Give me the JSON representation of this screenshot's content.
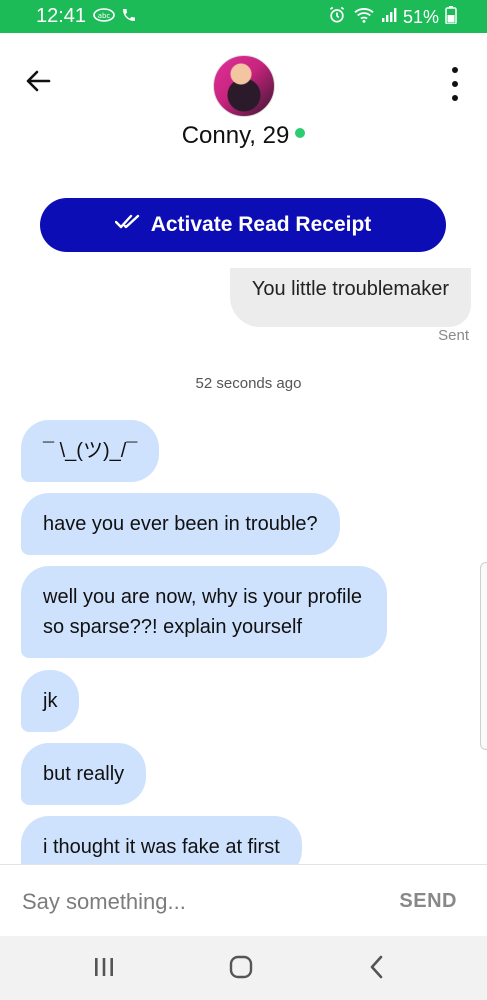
{
  "status_bar": {
    "time": "12:41",
    "battery": "51%",
    "icons": [
      "carrier-icon",
      "phone-icon",
      "alarm-icon",
      "wifi-icon",
      "signal-icon",
      "battery-icon"
    ],
    "background": "#1dbb58"
  },
  "header": {
    "name": "Conny, 29",
    "online": true,
    "online_color": "#2ecc71"
  },
  "activate_button": {
    "label": "Activate Read Receipt",
    "color": "#0d0db5"
  },
  "messages": {
    "sent": {
      "text": "You little troublemaker",
      "status": "Sent"
    },
    "timestamp": "52 seconds ago",
    "received": [
      {
        "text": "¯ \\_(ツ)_/¯"
      },
      {
        "text": "have you ever been in trouble?"
      },
      {
        "text": "well you are now, why is your profile so sparse??! explain yourself"
      },
      {
        "text": "jk"
      },
      {
        "text": "but really"
      },
      {
        "text": "i thought it was fake at first"
      }
    ],
    "received_color": "#cfe2fd"
  },
  "composer": {
    "placeholder": "Say something...",
    "send_label": "SEND"
  },
  "nav": {
    "icons": [
      "recents-icon",
      "home-icon",
      "back-icon"
    ]
  }
}
